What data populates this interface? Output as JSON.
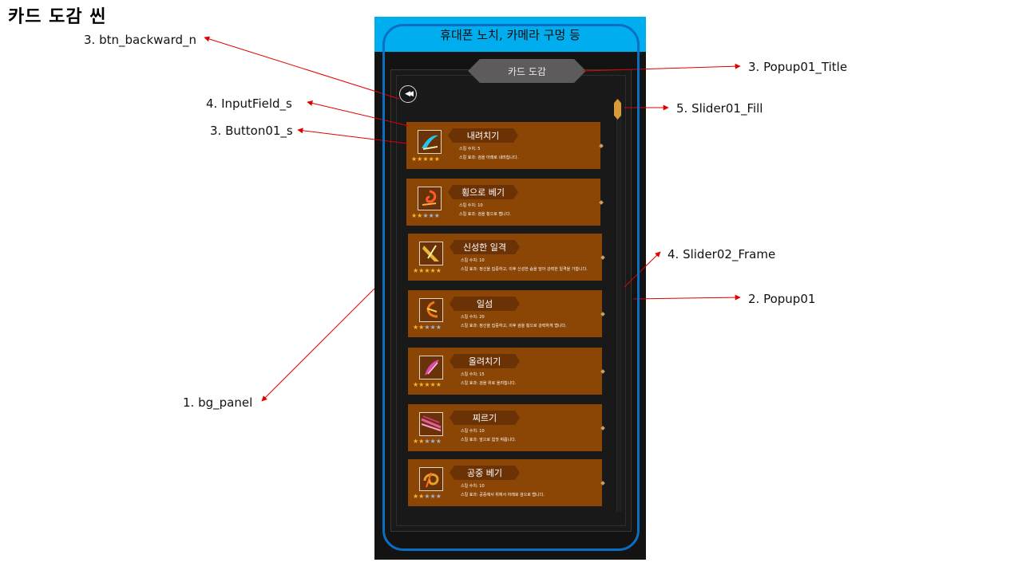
{
  "heading": "카드 도감 씬",
  "labels": {
    "btn_backward": "3. btn_backward_n",
    "input_field": "4. InputField_s",
    "button01": "3. Button01_s",
    "bg_panel": "1. bg_panel",
    "popup_title": "3. Popup01_Title",
    "slider_fill": "5. Slider01_Fill",
    "slider_frame": "4. Slider02_Frame",
    "popup01": "2. Popup01"
  },
  "colors": {
    "notch": "#00aeef",
    "bezel": "#0b6ec5",
    "card": "#8b4504",
    "arrow": "#e00000"
  },
  "phone": {
    "notch_text": "휴대폰 노치, 카메라 구멍 등",
    "popup_title": "카드 도감",
    "back_icon": "rewind-icon"
  },
  "cards": [
    {
      "title": "내려치기",
      "number": "스킬 수치: 5",
      "effect": "스킬 효과: 검을 아래로 내려칩니다.",
      "stars": 5,
      "icon": "sword-slash-icon"
    },
    {
      "title": "횡으로 베기",
      "number": "스킬 수치: 10",
      "effect": "스킬 효과: 검을 횡으로 벱니다.",
      "stars": 2,
      "icon": "spiral-slash-icon"
    },
    {
      "title": "신성한 일격",
      "number": "스킬 수치: 10",
      "effect": "스킬 효과: 정신을 집중하고, 이후 신성한 숨을 담아 강력한 일격을 가합니다.",
      "stars": 5,
      "icon": "holy-strike-icon"
    },
    {
      "title": "일섬",
      "number": "스킬 수치: 20",
      "effect": "스킬 효과: 정신을 집중하고, 이후 검을 횡으로 강력하게 벱니다.",
      "stars": 2,
      "icon": "flash-slash-icon"
    },
    {
      "title": "올려치기",
      "number": "스킬 수치: 15",
      "effect": "스킬 효과: 검을 위로 올려칩니다.",
      "stars": 5,
      "icon": "upper-slash-icon"
    },
    {
      "title": "찌르기",
      "number": "스킬 수치: 10",
      "effect": "스킬 효과: 앞으로 힘껏 찌릅니다.",
      "stars": 2,
      "icon": "thrust-icon"
    },
    {
      "title": "공중 베기",
      "number": "스킬 수치: 10",
      "effect": "스킬 효과: 공중에서 위에서 아래로 검으로 벱니다.",
      "stars": 2,
      "icon": "air-slash-icon"
    }
  ]
}
